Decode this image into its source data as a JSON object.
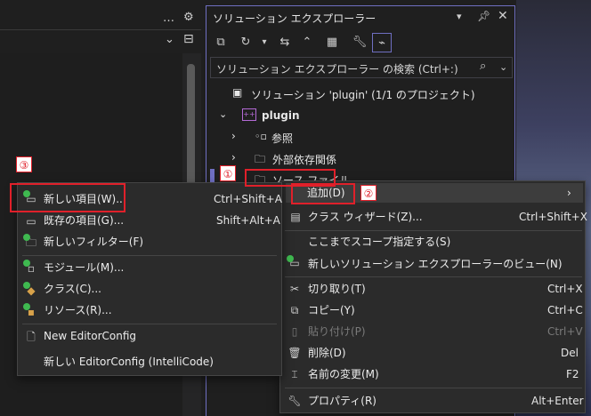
{
  "solution_explorer": {
    "title": "ソリューション エクスプローラー",
    "search_placeholder": "ソリューション エクスプローラー の検索 (Ctrl+:)",
    "tree": {
      "solution": "ソリューション 'plugin' (1/1 のプロジェクト)",
      "project": "plugin",
      "references": "参照",
      "external_deps": "外部依存関係",
      "source_files": "ソース ファイル"
    }
  },
  "context_menu": {
    "items": [
      {
        "label": "追加(D)",
        "shortcut": ""
      },
      {
        "label": "クラス ウィザード(Z)...",
        "shortcut": "Ctrl+Shift+X"
      },
      {
        "label": "ここまでスコープ指定する(S)",
        "shortcut": ""
      },
      {
        "label": "新しいソリューション エクスプローラーのビュー(N)",
        "shortcut": ""
      },
      {
        "label": "切り取り(T)",
        "shortcut": "Ctrl+X"
      },
      {
        "label": "コピー(Y)",
        "shortcut": "Ctrl+C"
      },
      {
        "label": "貼り付け(P)",
        "shortcut": "Ctrl+V"
      },
      {
        "label": "削除(D)",
        "shortcut": "Del"
      },
      {
        "label": "名前の変更(M)",
        "shortcut": "F2"
      },
      {
        "label": "プロパティ(R)",
        "shortcut": "Alt+Enter"
      }
    ]
  },
  "submenu": {
    "items": [
      {
        "label": "新しい項目(W)...",
        "shortcut": "Ctrl+Shift+A"
      },
      {
        "label": "既存の項目(G)...",
        "shortcut": "Shift+Alt+A"
      },
      {
        "label": "新しいフィルター(F)",
        "shortcut": ""
      },
      {
        "label": "モジュール(M)...",
        "shortcut": ""
      },
      {
        "label": "クラス(C)...",
        "shortcut": ""
      },
      {
        "label": "リソース(R)...",
        "shortcut": ""
      },
      {
        "label": "New EditorConfig",
        "shortcut": ""
      },
      {
        "label": "新しい EditorConfig (IntelliCode)",
        "shortcut": ""
      }
    ]
  },
  "annotations": {
    "one": "①",
    "two": "②",
    "three": "③"
  },
  "colors": {
    "accent": "#6f6fc2",
    "highlight": "#e0202a",
    "add_green": "#3fb950"
  }
}
